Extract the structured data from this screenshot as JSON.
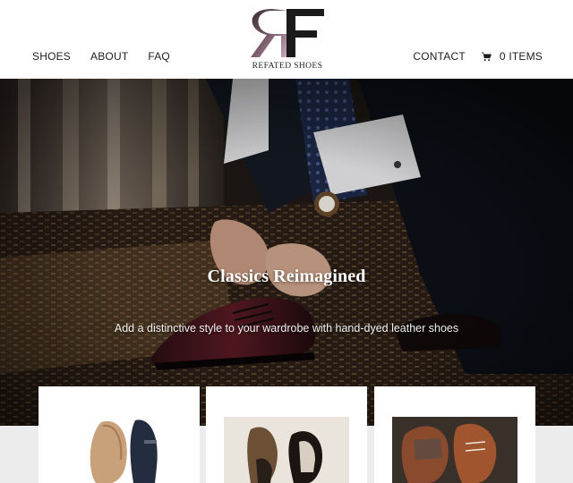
{
  "brand": {
    "monogram": "RF",
    "name": "REFATED SHOES"
  },
  "nav": {
    "left": [
      "SHOES",
      "ABOUT",
      "FAQ"
    ],
    "contact": "CONTACT",
    "cart_label": "0 ITEMS"
  },
  "hero": {
    "title": "Classics Reimagined",
    "subtitle": "Add a distinctive style to your wardrobe with hand-dyed leather shoes"
  },
  "icons": {
    "cart": "cart-icon",
    "logo": "rf-monogram-logo"
  },
  "colors": {
    "logo_accent": "#5a2a3a",
    "header_bg": "#ffffff",
    "lower_bg": "#ececec"
  }
}
